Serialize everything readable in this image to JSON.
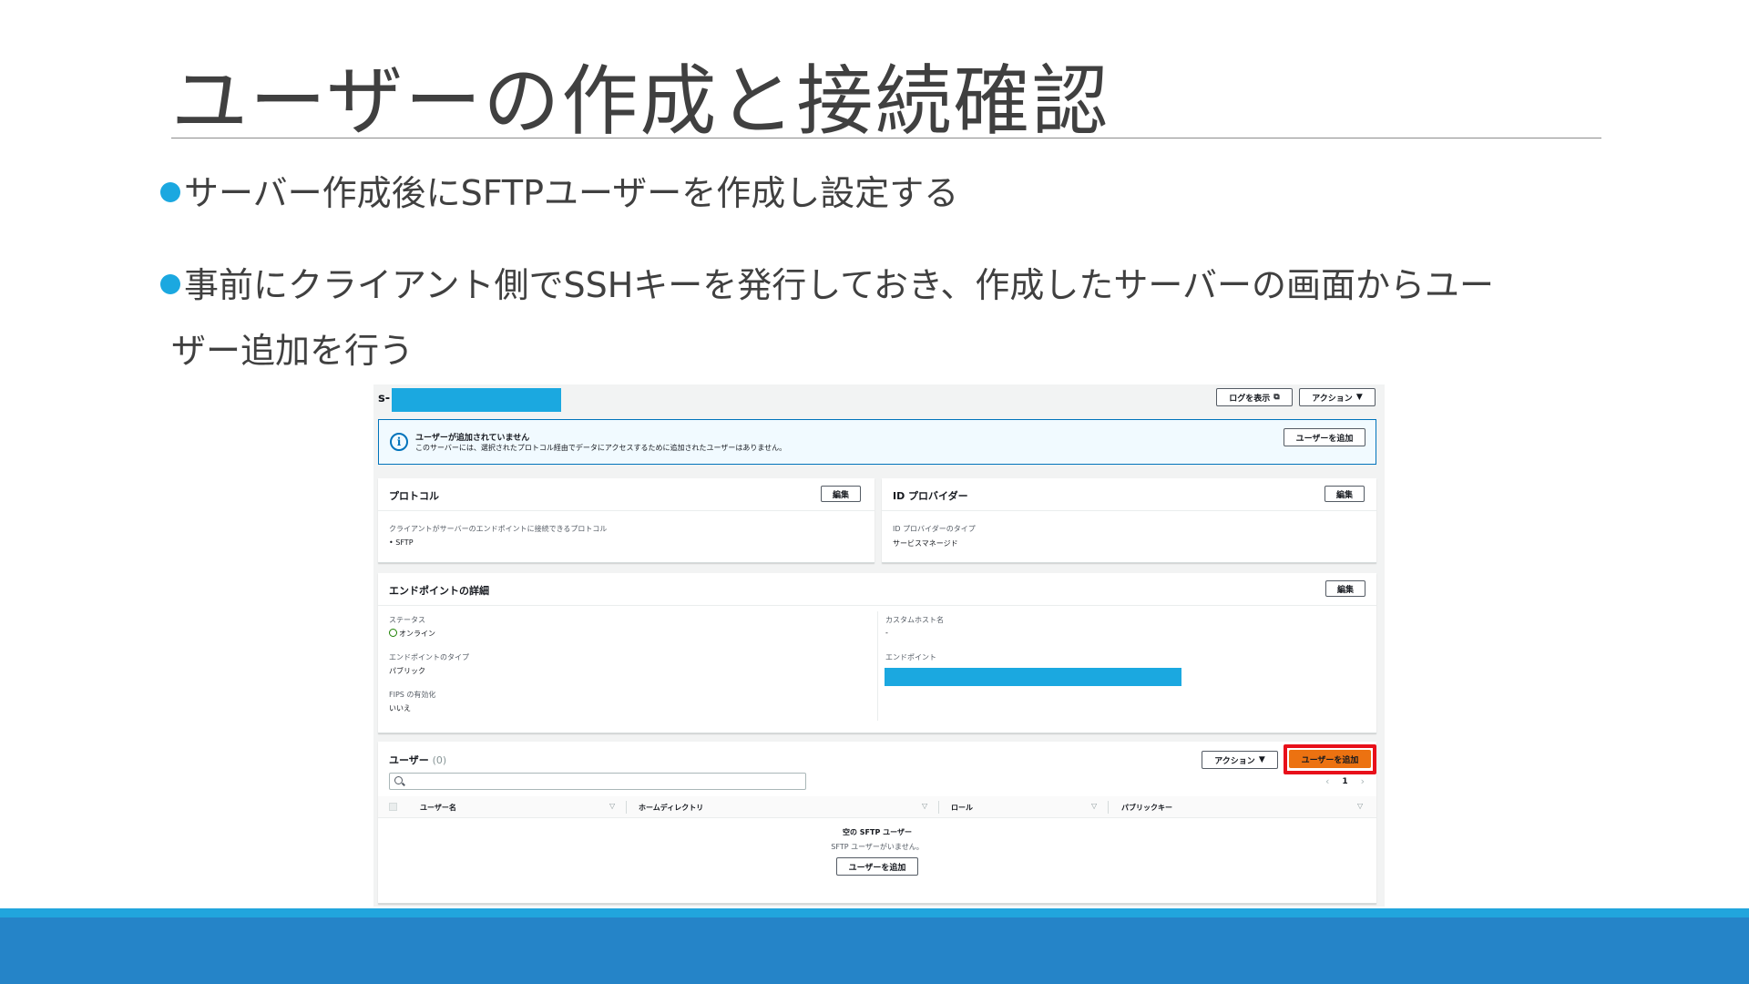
{
  "slide": {
    "title": "ユーザーの作成と接続確認",
    "bullet1": "サーバー作成後にSFTPユーザーを作成し設定する",
    "bullet2_line1": "事前にクライアント側でSSHキーを発行しておき、作成したサーバーの画面からユー",
    "bullet2_line2": "ザー追加を行う"
  },
  "console": {
    "server_id_prefix": "s-",
    "header_buttons": {
      "logs": "ログを表示",
      "actions": "アクション"
    },
    "alert": {
      "title": "ユーザーが追加されていません",
      "body": "このサーバーには、選択されたプロトコル経由でデータにアクセスするために追加されたユーザーはありません。",
      "button": "ユーザーを追加"
    },
    "protocol_panel": {
      "title": "プロトコル",
      "edit": "編集",
      "label": "クライアントがサーバーのエンドポイントに接続できるプロトコル",
      "value": "•  SFTP"
    },
    "idp_panel": {
      "title": "ID プロバイダー",
      "edit": "編集",
      "label": "ID プロバイダーのタイプ",
      "value": "サービスマネージド"
    },
    "endpoint_panel": {
      "title": "エンドポイントの詳細",
      "edit": "編集",
      "status_label": "ステータス",
      "status_value": "オンライン",
      "type_label": "エンドポイントのタイプ",
      "type_value": "パブリック",
      "fips_label": "FIPS の有効化",
      "fips_value": "いいえ",
      "custom_host_label": "カスタムホスト名",
      "custom_host_value": "-",
      "endpoint_label": "エンドポイント"
    },
    "users_panel": {
      "title": "ユーザー",
      "count": "(0)",
      "actions": "アクション",
      "add_button": "ユーザーを追加",
      "page": "1",
      "columns": [
        "ユーザー名",
        "ホームディレクトリ",
        "ロール",
        "パブリックキー"
      ],
      "empty_title": "空の SFTP ユーザー",
      "empty_body": "SFTP ユーザーがいません。",
      "empty_button": "ユーザーを追加"
    }
  },
  "colors": {
    "accent_blue": "#1ba8e0",
    "footer_blue": "#2584c8",
    "primary_orange": "#ec7211",
    "highlight_red": "#e8101a",
    "status_green": "#1d8102"
  }
}
